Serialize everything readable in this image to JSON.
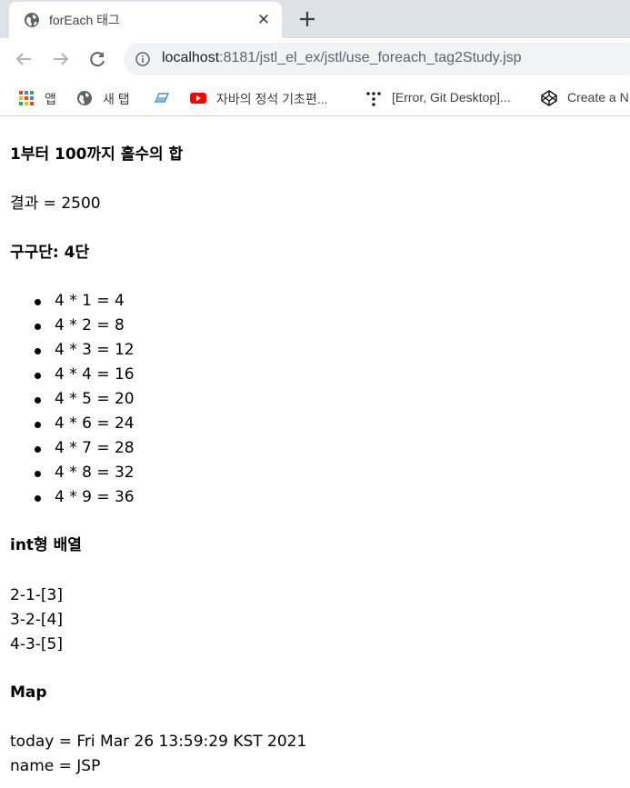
{
  "browser": {
    "tab": {
      "title": "forEach 태그",
      "close_glyph": "✕"
    },
    "new_tab_glyph": "+",
    "address": {
      "host": "localhost",
      "path": ":8181/jstl_el_ex/jstl/use_foreach_tag2Study.jsp"
    },
    "bookmarks": [
      {
        "label": "앱",
        "icon": "apps-grid-icon"
      },
      {
        "label": "새 탭",
        "icon": "globe-icon"
      },
      {
        "label": "",
        "icon": "edge-like-icon"
      },
      {
        "label": "자바의 정석 기초편...",
        "icon": "youtube-icon"
      },
      {
        "label": "[Error, Git Desktop]...",
        "icon": "dots-icon"
      },
      {
        "label": "Create a N",
        "icon": "codepen-icon"
      }
    ]
  },
  "page": {
    "sum_heading": "1부터 100까지 홀수의 합",
    "sum_result": "결과 = 2500",
    "gugudan_heading": "구구단: 4단",
    "gugudan_items": [
      "4 * 1 = 4",
      "4 * 2 = 8",
      "4 * 3 = 12",
      "4 * 4 = 16",
      "4 * 5 = 20",
      "4 * 6 = 24",
      "4 * 7 = 28",
      "4 * 8 = 32",
      "4 * 9 = 36"
    ],
    "array_heading": "int형 배열",
    "array_lines": [
      "2-1-[3]",
      "3-2-[4]",
      "4-3-[5]"
    ],
    "map_heading": "Map",
    "map_lines": [
      "today = Fri Mar 26 13:59:29 KST 2021",
      "name = JSP"
    ]
  }
}
